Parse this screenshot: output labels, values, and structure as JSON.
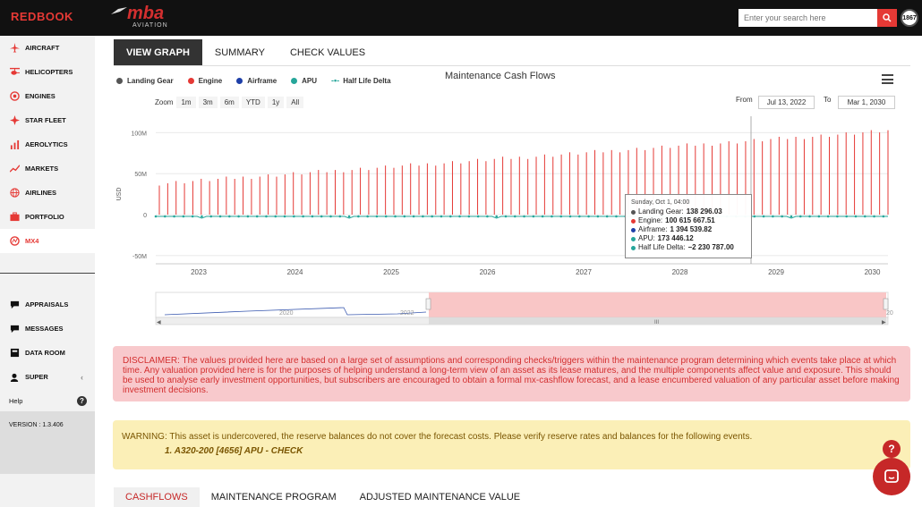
{
  "topbar": {
    "brand": "REDBOOK",
    "logo_text": "mba",
    "logo_sub": "AVIATION",
    "search_placeholder": "Enter your search here",
    "avatar_text": "1867"
  },
  "sidebar": {
    "items": [
      {
        "label": "AIRCRAFT",
        "icon": "plane-icon"
      },
      {
        "label": "HELICOPTERS",
        "icon": "helicopter-icon"
      },
      {
        "label": "ENGINES",
        "icon": "engine-icon"
      },
      {
        "label": "STAR FLEET",
        "icon": "star-icon"
      },
      {
        "label": "AEROLYTICS",
        "icon": "analytics-icon"
      },
      {
        "label": "MARKETS",
        "icon": "trend-icon"
      },
      {
        "label": "AIRLINES",
        "icon": "globe-icon"
      },
      {
        "label": "PORTFOLIO",
        "icon": "briefcase-icon"
      },
      {
        "label": "MX4",
        "icon": "mx4-icon"
      }
    ],
    "lower_items": [
      {
        "label": "APPRAISALS",
        "icon": "chat-icon"
      },
      {
        "label": "MESSAGES",
        "icon": "message-icon"
      },
      {
        "label": "DATA ROOM",
        "icon": "dataroom-icon"
      },
      {
        "label": "SUPER",
        "icon": "user-icon"
      }
    ],
    "help_label": "Help",
    "version": "VERSION : 1.3.406"
  },
  "tabs": [
    "VIEW GRAPH",
    "SUMMARY",
    "CHECK VALUES"
  ],
  "chart": {
    "title": "Maintenance Cash Flows",
    "legend": [
      {
        "label": "Landing Gear",
        "color": "#555555"
      },
      {
        "label": "Engine",
        "color": "#e53935"
      },
      {
        "label": "Airframe",
        "color": "#1e3fa8"
      },
      {
        "label": "APU",
        "color": "#26a69a"
      },
      {
        "label": "Half Life Delta",
        "color": "#26a69a"
      }
    ],
    "zoom_label": "Zoom",
    "zoom_buttons": [
      "1m",
      "3m",
      "6m",
      "YTD",
      "1y",
      "All"
    ],
    "from_label": "From",
    "from_value": "Jul 13, 2022",
    "to_label": "To",
    "to_value": "Mar 1, 2030",
    "navigator_labels": [
      "2020",
      "2022",
      "20"
    ]
  },
  "chart_data": {
    "type": "bar",
    "ylabel": "USD",
    "yticks": [
      "100M",
      "50M",
      "0",
      "-50M"
    ],
    "ylim": [
      -60000000,
      120000000
    ],
    "x": [
      "2023",
      "2024",
      "2025",
      "2026",
      "2027",
      "2028",
      "2029",
      "2030"
    ],
    "series": [
      {
        "name": "Engine",
        "values_start": 38000000,
        "values_end": 102000000,
        "count": 88
      }
    ],
    "tooltip": {
      "date": "Sunday, Oct 1, 04:00",
      "rows": [
        {
          "label": "Landing Gear:",
          "value": "138 296.03",
          "color": "#555555"
        },
        {
          "label": "Engine:",
          "value": "100 615 667.51",
          "color": "#e53935"
        },
        {
          "label": "Airframe:",
          "value": "1 394 539.82",
          "color": "#1e3fa8"
        },
        {
          "label": "APU:",
          "value": "173 446.12",
          "color": "#26a69a"
        },
        {
          "label": "Half Life Delta:",
          "value": "−2 230 787.00",
          "color": "#26a69a"
        }
      ]
    }
  },
  "disclaimer": "DISCLAIMER: The values provided here are based on a large set of assumptions and corresponding checks/triggers within the maintenance program determining which events take place at which time. Any valuation provided here is for the purposes of helping understand a long-term view of an asset as its lease matures, and the multiple components affect value and exposure. This should be used to analyse early investment opportunities, but subscribers are encouraged to obtain a formal mx-cashflow forecast, and a lease encumbered valuation of any particular asset before making investment decisions.",
  "warning": {
    "text": "WARNING: This asset is undercovered, the reserve balances do not cover the forecast costs. Please verify reserve rates and balances for the following events.",
    "item": "1. A320-200 [4656] APU - CHECK"
  },
  "bottom_tabs": [
    "CASHFLOWS",
    "MAINTENANCE PROGRAM",
    "ADJUSTED MAINTENANCE VALUE"
  ]
}
